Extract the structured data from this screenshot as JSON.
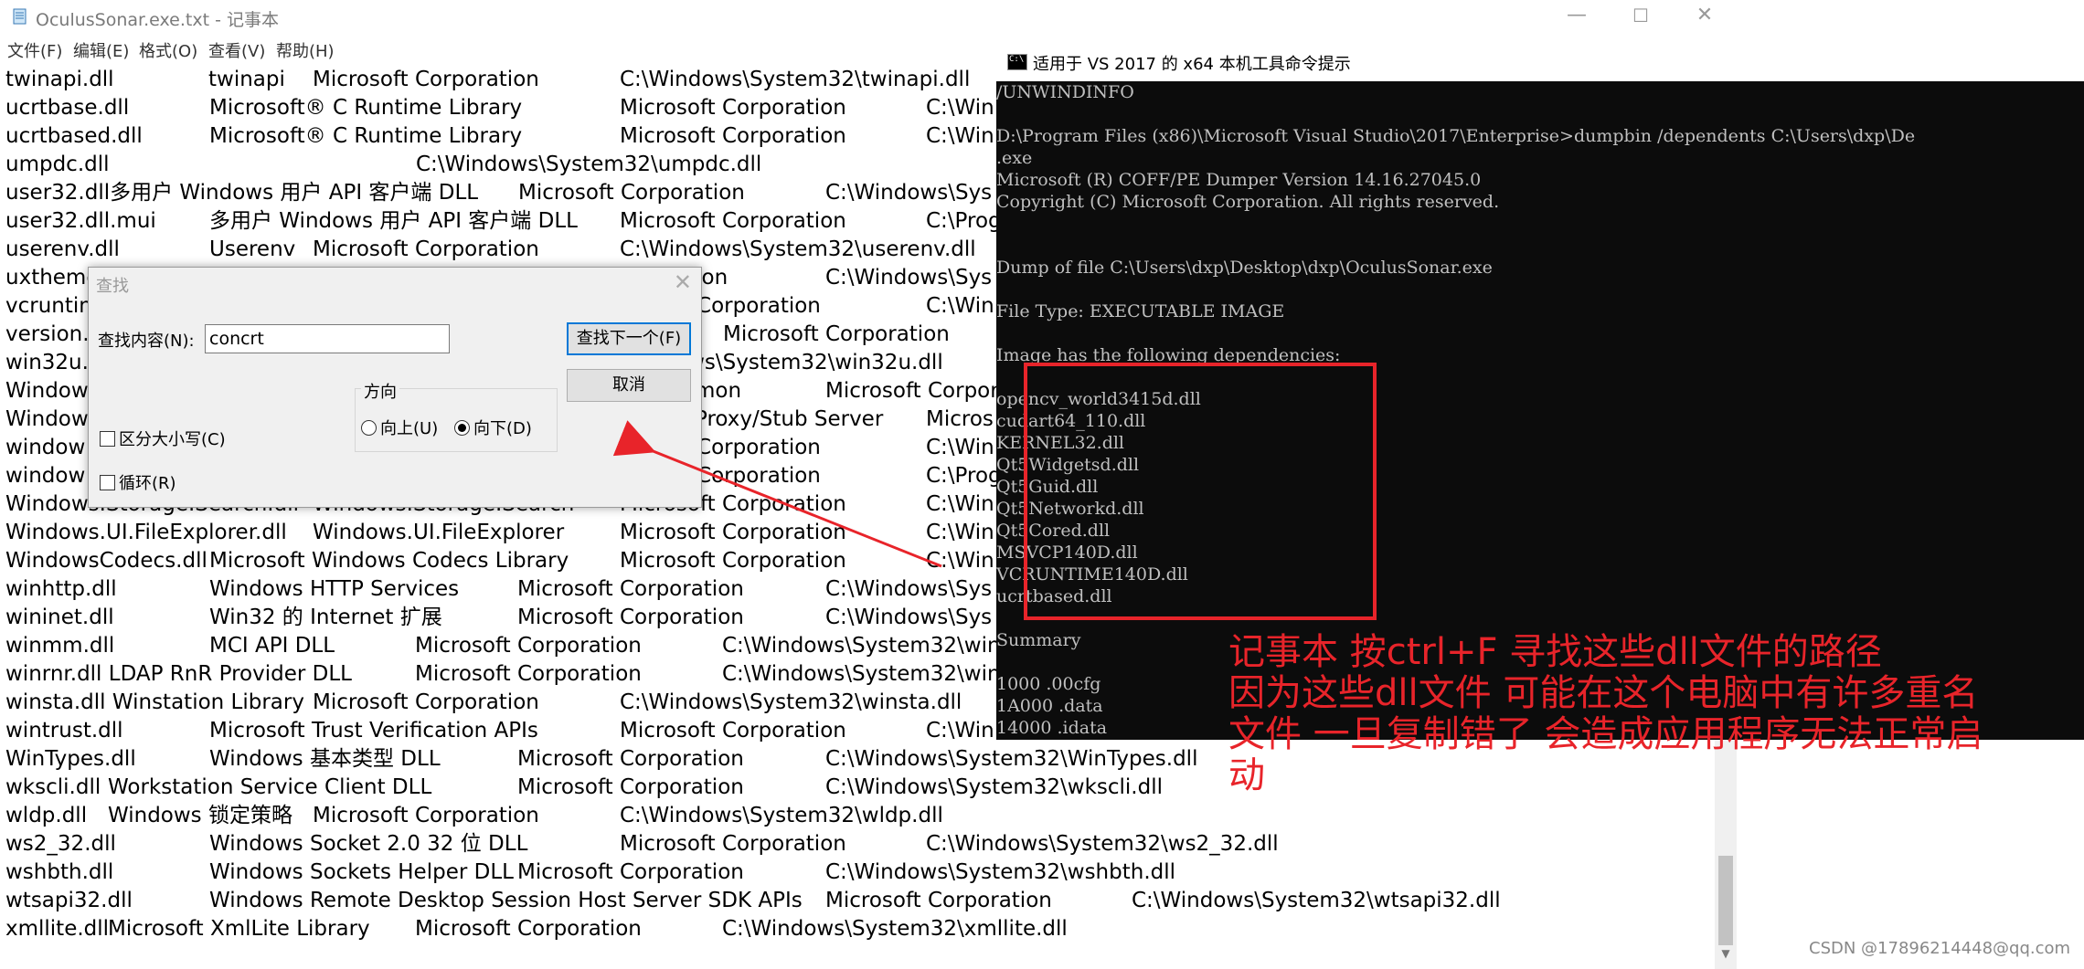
{
  "notepad": {
    "title": "OculusSonar.exe.txt - 记事本",
    "controls": {
      "minimize": "—",
      "maximize": "☐",
      "close": "✕"
    },
    "menu": [
      "文件(F)",
      "编辑(E)",
      "格式(O)",
      "查看(V)",
      "帮助(H)"
    ],
    "lines": [
      [
        "twinapi.dll",
        "twinapi",
        "Microsoft Corporation",
        "C:\\Windows\\System32\\twinapi.dll"
      ],
      [
        "ucrtbase.dll",
        "Microsoft® C Runtime Library",
        "Microsoft Corporation",
        "C:\\Win"
      ],
      [
        "ucrtbased.dll",
        "Microsoft® C Runtime Library",
        "Microsoft Corporation",
        "C:\\Win"
      ],
      [
        "umpdc.dll",
        "C:\\Windows\\System32\\umpdc.dll"
      ],
      [
        "user32.dll多用户 Windows 用户 API 客户端 DLL",
        "Microsoft Corporation",
        "C:\\Windows\\Sys"
      ],
      [
        "user32.dll.mui",
        "多用户 Windows 用户 API 客户端 DLL",
        "Microsoft Corporation",
        "C:\\Prog"
      ],
      [
        "userenv.dll",
        "Userenv",
        "Microsoft Corporation",
        "C:\\Windows\\System32\\userenv.dll"
      ],
      [
        "uxtheme",
        "ation",
        "C:\\Windows\\Sys"
      ],
      [
        "vcruntin",
        "ft Corporation",
        "C:\\Win"
      ],
      [
        "version.",
        "Microsoft Corporation"
      ],
      [
        "win32u.",
        "ows\\System32\\win32u.dll"
      ],
      [
        "Window",
        "mon",
        "Microsoft Corpor"
      ],
      [
        "Window",
        "Proxy/Stub Server",
        "Micros"
      ],
      [
        "window",
        "ft Corporation",
        "C:\\Win"
      ],
      [
        "window",
        "ft Corporation",
        "C:\\Prog"
      ],
      [
        "Windows.Storage.Search.dll",
        "Windows.Storage.Search",
        "Microsoft Corporation",
        "C:\\Win"
      ],
      [
        "Windows.UI.FileExplorer.dll",
        "Windows.UI.FileExplorer",
        "Microsoft Corporation",
        "C:\\Win"
      ],
      [
        "WindowsCodecs.dll",
        "Microsoft Windows Codecs Library",
        "Microsoft Corporation",
        "C:\\Win"
      ],
      [
        "winhttp.dll",
        "Windows HTTP Services",
        "Microsoft Corporation",
        "C:\\Windows\\Sys"
      ],
      [
        "wininet.dll",
        "Win32 的 Internet 扩展",
        "Microsoft Corporation",
        "C:\\Windows\\Sys"
      ],
      [
        "winmm.dll",
        "MCI API DLL",
        "Microsoft Corporation",
        "C:\\Windows\\System32\\win"
      ],
      [
        "winrnr.dll LDAP RnR Provider DLL",
        "Microsoft Corporation",
        "C:\\Windows\\System32\\win"
      ],
      [
        "winsta.dll Winstation Library",
        "Microsoft Corporation",
        "C:\\Windows\\System32\\winsta.dll"
      ],
      [
        "wintrust.dll",
        "Microsoft Trust Verification APIs",
        "Microsoft Corporation",
        "C:\\Win"
      ],
      [
        "WinTypes.dll",
        "Windows 基本类型 DLL",
        "Microsoft Corporation",
        "C:\\Windows\\System32\\WinTypes.dll"
      ],
      [
        "wkscli.dll",
        "Workstation Service Client DLL",
        "Microsoft Corporation",
        "C:\\Windows\\System32\\wkscli.dll"
      ],
      [
        "wldp.dll",
        "Windows 锁定策略",
        "Microsoft Corporation",
        "C:\\Windows\\System32\\wldp.dll"
      ],
      [
        "ws2_32.dll",
        "Windows Socket 2.0 32 位 DLL",
        "Microsoft Corporation",
        "C:\\Windows\\System32\\ws2_32.dll"
      ],
      [
        "wshbth.dll",
        "Windows Sockets Helper DLL",
        "Microsoft Corporation",
        "C:\\Windows\\System32\\wshbth.dll"
      ],
      [
        "wtsapi32.dll",
        "Windows Remote Desktop Session Host Server SDK APIs",
        "Microsoft Corporation",
        "C:\\Windows\\System32\\wtsapi32.dll"
      ],
      [
        "xmllite.dll",
        "Microsoft XmlLite Library",
        "Microsoft Corporation",
        "C:\\Windows\\System32\\xmllite.dll"
      ]
    ]
  },
  "find_dialog": {
    "title": "查找",
    "close": "✕",
    "find_label": "查找内容(N):",
    "find_value": "concrt",
    "find_next": "查找下一个(F)",
    "cancel": "取消",
    "direction_label": "方向",
    "up": "向上(U)",
    "down": "向下(D)",
    "match_case": "区分大小写(C)",
    "wrap": "循环(R)"
  },
  "cmd": {
    "title": "适用于 VS 2017 的 x64 本机工具命令提示",
    "lines": [
      "  /UNWINDINFO",
      "",
      "D:\\Program Files (x86)\\Microsoft Visual Studio\\2017\\Enterprise>dumpbin /dependents  C:\\Users\\dxp\\De",
      ".exe",
      "Microsoft (R) COFF/PE Dumper Version 14.16.27045.0",
      "Copyright (C) Microsoft Corporation.  All rights reserved.",
      "",
      "",
      "Dump of file C:\\Users\\dxp\\Desktop\\dxp\\OculusSonar.exe",
      "",
      "File Type: EXECUTABLE IMAGE",
      "",
      "  Image has the following dependencies:",
      "",
      "    opencv_world3415d.dll",
      "    cudart64_110.dll",
      "    KERNEL32.dll",
      "    Qt5Widgetsd.dll",
      "    Qt5Guid.dll",
      "    Qt5Networkd.dll",
      "    Qt5Cored.dll",
      "    MSVCP140D.dll",
      "    VCRUNTIME140D.dll",
      "    ucrtbased.dll",
      "",
      "  Summary",
      "",
      "        1000 .00cfg",
      "       1A000 .data",
      "       14000 .idata"
    ]
  },
  "annotation": {
    "lines": [
      "记事本 按ctrl+F 寻找这些dll文件的路径",
      "因为这些dll文件 可能在这个电脑中有许多重名",
      "文件 一旦复制错了 会造成应用程序无法正常启",
      "动"
    ],
    "color": "#e8242a"
  },
  "watermark": "CSDN @17896214448@qq.com"
}
